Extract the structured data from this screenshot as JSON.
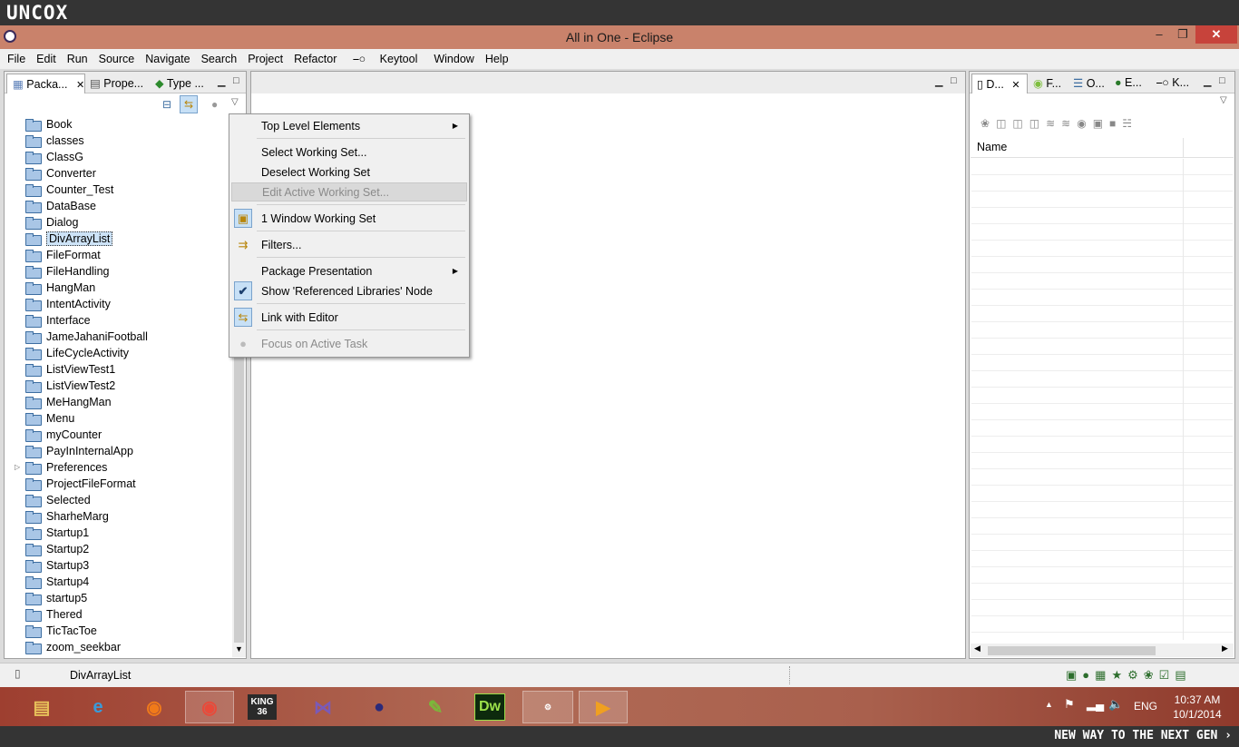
{
  "brand": {
    "top": "UNCOX",
    "bottom": "NEW WAY TO THE NEXT GEN ›"
  },
  "window": {
    "title": "All in One - Eclipse",
    "minimize": "–",
    "restore": "❐",
    "close": "✕"
  },
  "menubar": [
    "File",
    "Edit",
    "Run",
    "Source",
    "Navigate",
    "Search",
    "Project",
    "Refactor",
    "Keytool",
    "Window",
    "Help"
  ],
  "left_tabs": [
    "Packa...",
    "Prope...",
    "Type ..."
  ],
  "tree": [
    {
      "label": "Book"
    },
    {
      "label": "classes"
    },
    {
      "label": "ClassG"
    },
    {
      "label": "Converter"
    },
    {
      "label": "Counter_Test"
    },
    {
      "label": "DataBase"
    },
    {
      "label": "Dialog"
    },
    {
      "label": "DivArrayList",
      "selected": true
    },
    {
      "label": "FileFormat"
    },
    {
      "label": "FileHandling"
    },
    {
      "label": "HangMan"
    },
    {
      "label": "IntentActivity"
    },
    {
      "label": "Interface"
    },
    {
      "label": "JameJahaniFootball"
    },
    {
      "label": "LifeCycleActivity"
    },
    {
      "label": "ListViewTest1"
    },
    {
      "label": "ListViewTest2"
    },
    {
      "label": "MeHangMan"
    },
    {
      "label": "Menu"
    },
    {
      "label": "myCounter"
    },
    {
      "label": "PayInInternalApp"
    },
    {
      "label": "Preferences",
      "expandable": true
    },
    {
      "label": "ProjectFileFormat"
    },
    {
      "label": "Selected"
    },
    {
      "label": "SharheMarg"
    },
    {
      "label": "Startup1"
    },
    {
      "label": "Startup2"
    },
    {
      "label": "Startup3"
    },
    {
      "label": "Startup4"
    },
    {
      "label": "startup5"
    },
    {
      "label": "Thered"
    },
    {
      "label": "TicTacToe"
    },
    {
      "label": "zoom_seekbar"
    }
  ],
  "context_menu": [
    {
      "label": "Top Level Elements",
      "submenu": true
    },
    {
      "label": "Select Working Set..."
    },
    {
      "label": "Deselect Working Set"
    },
    {
      "label": "Edit Active Working Set...",
      "disabled": true
    },
    {
      "label": "1 Window Working Set",
      "icon": "working-set-icon"
    },
    {
      "label": "Filters...",
      "icon": "filter-icon"
    },
    {
      "label": "Package Presentation",
      "submenu": true
    },
    {
      "label": "Show 'Referenced Libraries' Node",
      "checked": true
    },
    {
      "label": "Link with Editor",
      "icon": "link-editor-icon"
    },
    {
      "label": "Focus on Active Task",
      "disabled": true,
      "icon": "focus-task-icon"
    }
  ],
  "right_tabs": [
    "D...",
    "F...",
    "O...",
    "E...",
    "K..."
  ],
  "right_table": {
    "column": "Name"
  },
  "status": {
    "selection": "DivArrayList"
  },
  "clock": {
    "time": "10:37 AM",
    "date": "10/1/2014"
  },
  "tray": {
    "lang": "ENG"
  },
  "taskbar": [
    "Explorer",
    "IE",
    "Firefox",
    "Chrome",
    "KING 36",
    "Visual Studio",
    "Eclipse",
    "Notepad++",
    "Dw",
    "Java EE IDE",
    "Media"
  ],
  "taskbar_labels": {
    "king": "KING\n36",
    "dw": "Dw",
    "javaee": "Java EE\nIDE"
  }
}
